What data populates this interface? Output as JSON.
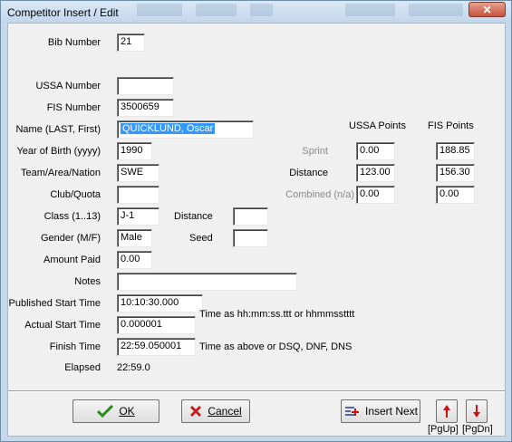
{
  "window": {
    "title": "Competitor Insert / Edit",
    "close_glyph": "✕"
  },
  "labels": {
    "bib": "Bib Number",
    "ussa_number": "USSA Number",
    "fis_number": "FIS Number",
    "name": "Name (LAST, First)",
    "yob": "Year of Birth (yyyy)",
    "team": "Team/Area/Nation",
    "club": "Club/Quota",
    "class": "Class (1..13)",
    "gender": "Gender (M/F)",
    "amount": "Amount Paid",
    "notes": "Notes",
    "pub_start": "Published Start Time",
    "act_start": "Actual Start Time",
    "finish": "Finish Time",
    "elapsed": "Elapsed",
    "distance_right": "Distance",
    "seed": "Seed",
    "sprint": "Sprint",
    "distance_pts": "Distance",
    "combined": "Combined (n/a)",
    "ussa_points_header": "USSA Points",
    "fis_points_header": "FIS Points",
    "time_hint1": "Time as hh:mm:ss.ttt or hhmmsstttt",
    "time_hint2": "Time as above or DSQ, DNF, DNS"
  },
  "values": {
    "bib": "21",
    "ussa_number": "",
    "fis_number": "3500659",
    "name": "QUICKLUND, Oscar",
    "yob": "1990",
    "team": "SWE",
    "club": "",
    "class": "J-1",
    "distance": "",
    "gender": "Male",
    "seed": "",
    "amount": "0.00",
    "notes": "",
    "pub_start": "10:10:30.000",
    "act_start": "0.000001",
    "finish": "22:59.050001",
    "elapsed": "22:59.0",
    "ussa_sprint": "0.00",
    "ussa_distance": "123.00",
    "ussa_combined": "0.00",
    "fis_sprint": "188.85",
    "fis_distance": "156.30",
    "fis_combined": "0.00"
  },
  "buttons": {
    "ok": "OK",
    "cancel": "Cancel",
    "insert_next": "Insert Next",
    "pgup": "[PgUp]",
    "pgdn": "[PgDn]"
  },
  "colors": {
    "ok_check": "#2a8a1a",
    "cancel_x": "#c02020",
    "arrow_red": "#cc1010",
    "selection": "#3399ff"
  }
}
